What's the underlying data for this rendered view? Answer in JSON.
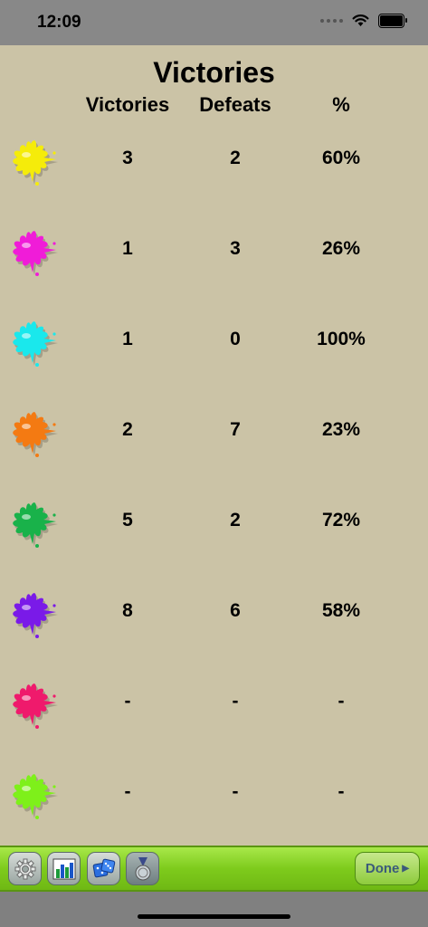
{
  "status": {
    "time": "12:09"
  },
  "title": "Victories",
  "columns": {
    "victories": "Victories",
    "defeats": "Defeats",
    "percent": "%"
  },
  "rows": [
    {
      "color": "#f5ec0a",
      "victories": "3",
      "defeats": "2",
      "percent": "60%"
    },
    {
      "color": "#f01cd8",
      "victories": "1",
      "defeats": "3",
      "percent": "26%"
    },
    {
      "color": "#1ae8ec",
      "victories": "1",
      "defeats": "0",
      "percent": "100%"
    },
    {
      "color": "#f47a12",
      "victories": "2",
      "defeats": "7",
      "percent": "23%"
    },
    {
      "color": "#19b24a",
      "victories": "5",
      "defeats": "2",
      "percent": "72%"
    },
    {
      "color": "#7a1ae8",
      "victories": "8",
      "defeats": "6",
      "percent": "58%"
    },
    {
      "color": "#ef1a6c",
      "victories": "-",
      "defeats": "-",
      "percent": "-"
    },
    {
      "color": "#7ef01a",
      "victories": "-",
      "defeats": "-",
      "percent": "-"
    }
  ],
  "toolbar": {
    "buttons": [
      {
        "name": "settings-button",
        "icon": "gear-icon"
      },
      {
        "name": "statistics-button",
        "icon": "bar-chart-icon"
      },
      {
        "name": "dice-button",
        "icon": "dice-icon"
      },
      {
        "name": "medal-button",
        "icon": "medal-icon",
        "active": true
      }
    ],
    "done_label": "Done"
  }
}
